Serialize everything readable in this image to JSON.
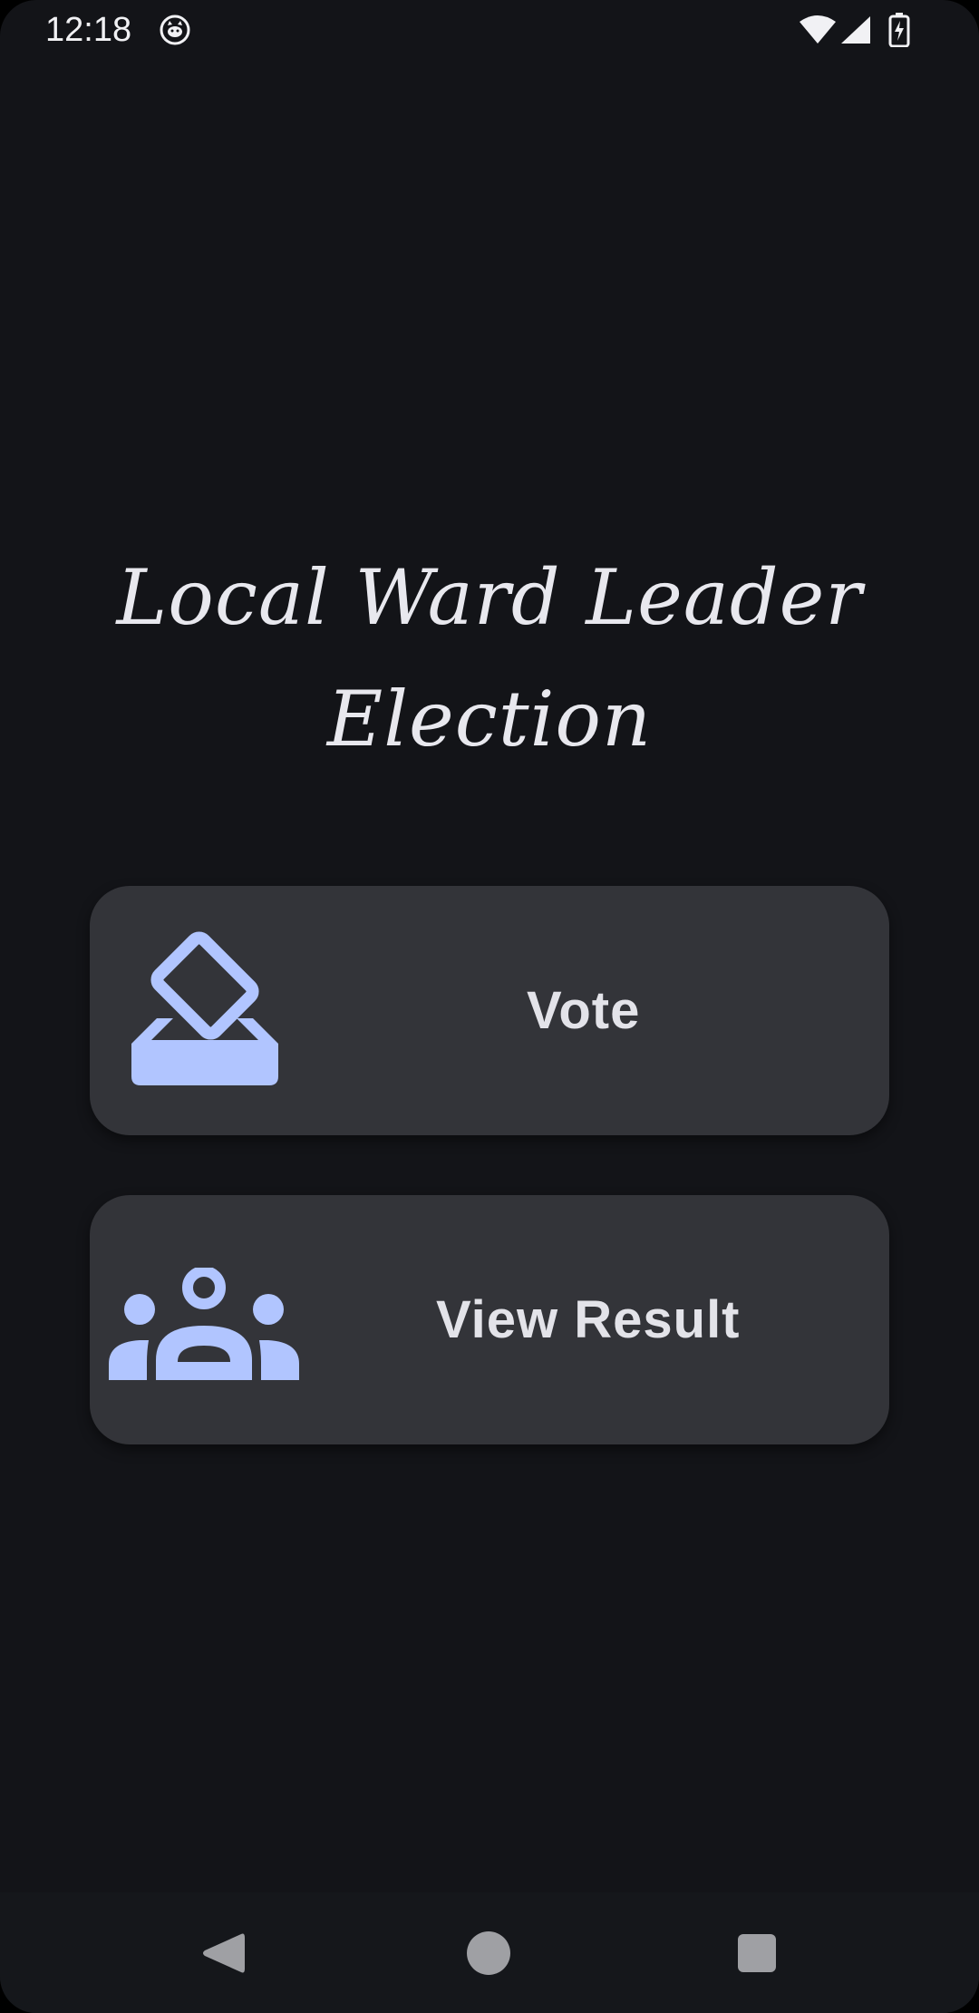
{
  "status_bar": {
    "time": "12:18",
    "app_icon": "cat-face-icon",
    "wifi_icon": "wifi-icon",
    "signal_icon": "cellular-signal-icon",
    "battery_icon": "battery-charging-icon"
  },
  "title": "Local Ward Leader Election",
  "cards": {
    "vote": {
      "label": "Vote",
      "icon": "ballot-box-icon"
    },
    "result": {
      "label": "View Result",
      "icon": "people-group-icon"
    }
  },
  "nav_bar": {
    "back_icon": "back-triangle-icon",
    "home_icon": "home-circle-icon",
    "recents_icon": "recents-square-icon"
  },
  "colors": {
    "background": "#131418",
    "card": "#333439",
    "icon_accent": "#b1c5ff",
    "text": "#e4e4ea",
    "nav_bar": "#15171b",
    "nav_icons": "#9fa0a4"
  }
}
